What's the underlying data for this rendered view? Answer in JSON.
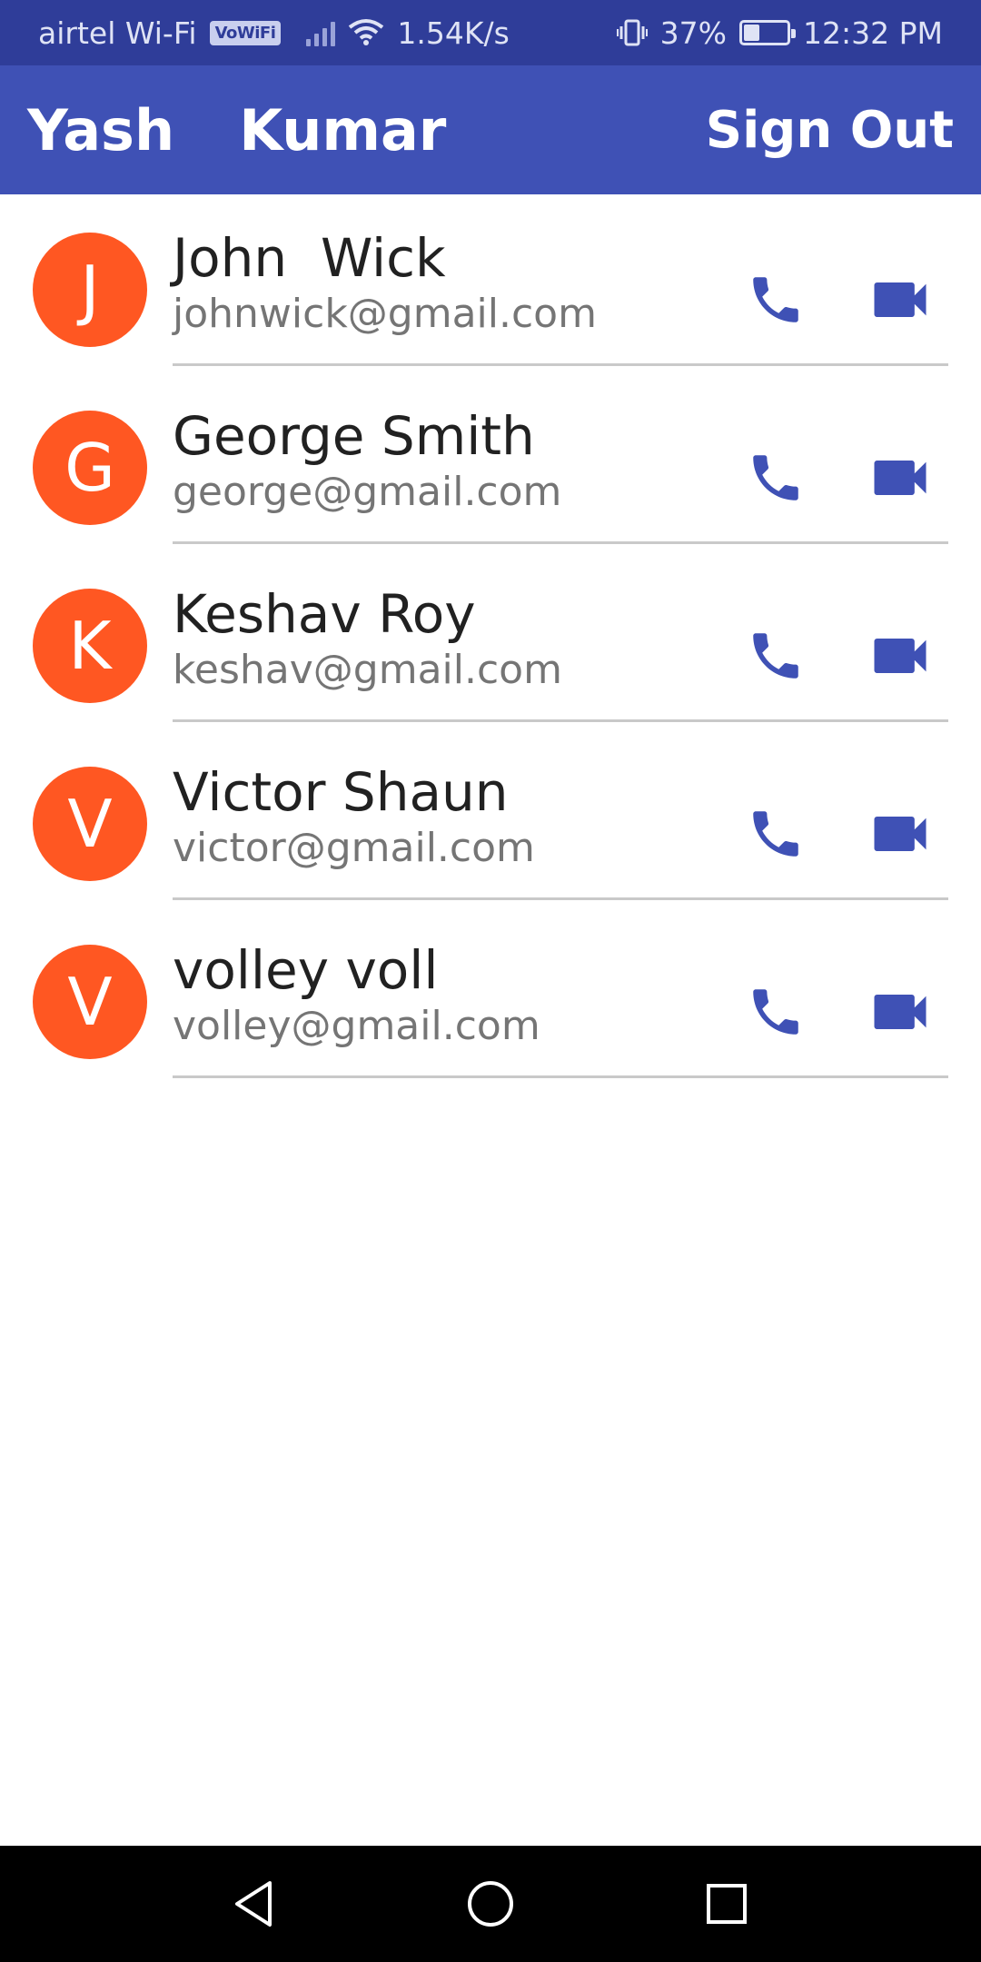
{
  "status_bar": {
    "carrier": "airtel Wi-Fi",
    "vowifi_badge": "VoWiFi",
    "net_speed": "1.54K/s",
    "battery_percent": "37%",
    "battery_level": 0.37,
    "time": "12:32 PM"
  },
  "app_bar": {
    "title": "Yash  Kumar",
    "sign_out_label": "Sign Out"
  },
  "contacts": [
    {
      "initial": "J",
      "name": "John  Wick",
      "email": "johnwick@gmail.com"
    },
    {
      "initial": "G",
      "name": "George Smith",
      "email": "george@gmail.com"
    },
    {
      "initial": "K",
      "name": "Keshav Roy",
      "email": "keshav@gmail.com"
    },
    {
      "initial": "V",
      "name": "Victor Shaun",
      "email": "victor@gmail.com"
    },
    {
      "initial": "V",
      "name": "volley voll",
      "email": "volley@gmail.com"
    }
  ],
  "icons": {
    "call": "phone-icon",
    "video": "video-camera-icon",
    "nav_back": "back-triangle-icon",
    "nav_home": "home-circle-icon",
    "nav_recents": "recents-square-icon"
  },
  "colors": {
    "status_bar": "#2f3d99",
    "app_bar": "#3f51b5",
    "avatar": "#ff5722",
    "action_icon": "#3f51b5",
    "divider": "#c9c9c9"
  }
}
